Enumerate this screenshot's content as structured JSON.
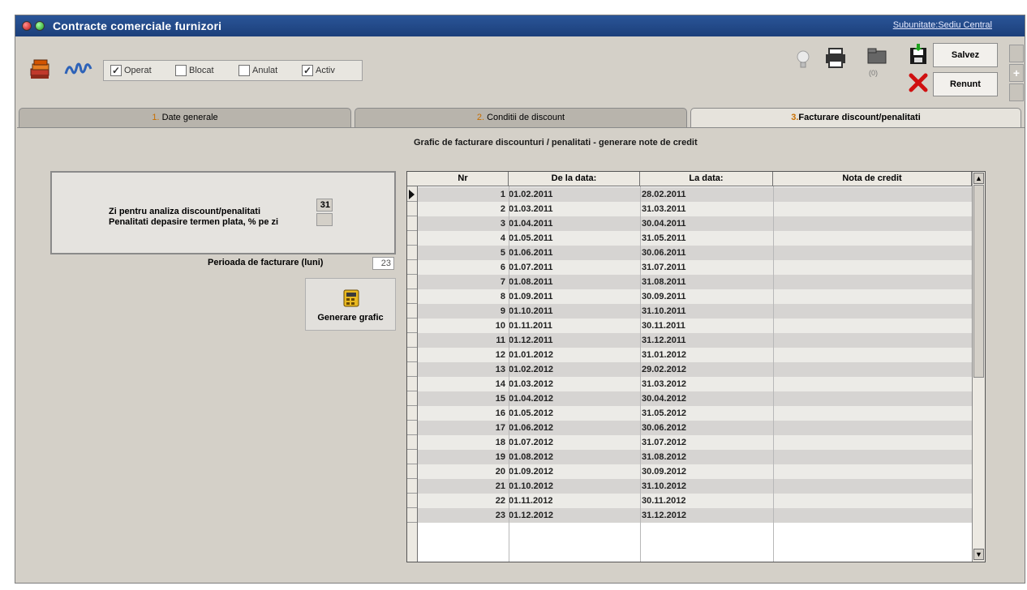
{
  "window": {
    "title": "Contracte comerciale furnizori",
    "subunit_link": "Subunitate:Sediu Central"
  },
  "toolbar": {
    "checkboxes": [
      {
        "label": "Operat",
        "checked": true
      },
      {
        "label": "Blocat",
        "checked": false
      },
      {
        "label": "Anulat",
        "checked": false
      },
      {
        "label": "Activ",
        "checked": true
      }
    ],
    "attach_count": "(0)",
    "save_label": "Salvez",
    "cancel_label": "Renunt"
  },
  "tabs": [
    {
      "num": "1.",
      "label": "Date generale"
    },
    {
      "num": "2.",
      "label": "Conditii de discount"
    },
    {
      "num": "3.",
      "label": "Facturare discount/penalitati"
    }
  ],
  "main": {
    "grid_caption": "Grafic de facturare discounturi / penalitati - generare note de credit",
    "params": {
      "day_label": "Zi pentru analiza discount/penalitati",
      "day_value": "31",
      "penalty_label": "Penalitati depasire termen plata, % pe zi",
      "penalty_value": ""
    },
    "period_label": "Perioada de facturare (luni)",
    "period_value": "23",
    "generate_label": "Generare grafic"
  },
  "grid": {
    "columns": [
      "Nr",
      "De la data:",
      "La data:",
      "Nota de credit"
    ],
    "rows": [
      [
        "1",
        "01.02.2011",
        "28.02.2011",
        ""
      ],
      [
        "2",
        "01.03.2011",
        "31.03.2011",
        ""
      ],
      [
        "3",
        "01.04.2011",
        "30.04.2011",
        ""
      ],
      [
        "4",
        "01.05.2011",
        "31.05.2011",
        ""
      ],
      [
        "5",
        "01.06.2011",
        "30.06.2011",
        ""
      ],
      [
        "6",
        "01.07.2011",
        "31.07.2011",
        ""
      ],
      [
        "7",
        "01.08.2011",
        "31.08.2011",
        ""
      ],
      [
        "8",
        "01.09.2011",
        "30.09.2011",
        ""
      ],
      [
        "9",
        "01.10.2011",
        "31.10.2011",
        ""
      ],
      [
        "10",
        "01.11.2011",
        "30.11.2011",
        ""
      ],
      [
        "11",
        "01.12.2011",
        "31.12.2011",
        ""
      ],
      [
        "12",
        "01.01.2012",
        "31.01.2012",
        ""
      ],
      [
        "13",
        "01.02.2012",
        "29.02.2012",
        ""
      ],
      [
        "14",
        "01.03.2012",
        "31.03.2012",
        ""
      ],
      [
        "15",
        "01.04.2012",
        "30.04.2012",
        ""
      ],
      [
        "16",
        "01.05.2012",
        "31.05.2012",
        ""
      ],
      [
        "17",
        "01.06.2012",
        "30.06.2012",
        ""
      ],
      [
        "18",
        "01.07.2012",
        "31.07.2012",
        ""
      ],
      [
        "19",
        "01.08.2012",
        "31.08.2012",
        ""
      ],
      [
        "20",
        "01.09.2012",
        "30.09.2012",
        ""
      ],
      [
        "21",
        "01.10.2012",
        "31.10.2012",
        ""
      ],
      [
        "22",
        "01.11.2012",
        "30.11.2012",
        ""
      ],
      [
        "23",
        "01.12.2012",
        "31.12.2012",
        ""
      ]
    ]
  },
  "colors": {
    "titlebar": "#1c3f7a",
    "accent_red": "#d01010",
    "tab_number": "#c86e00"
  }
}
